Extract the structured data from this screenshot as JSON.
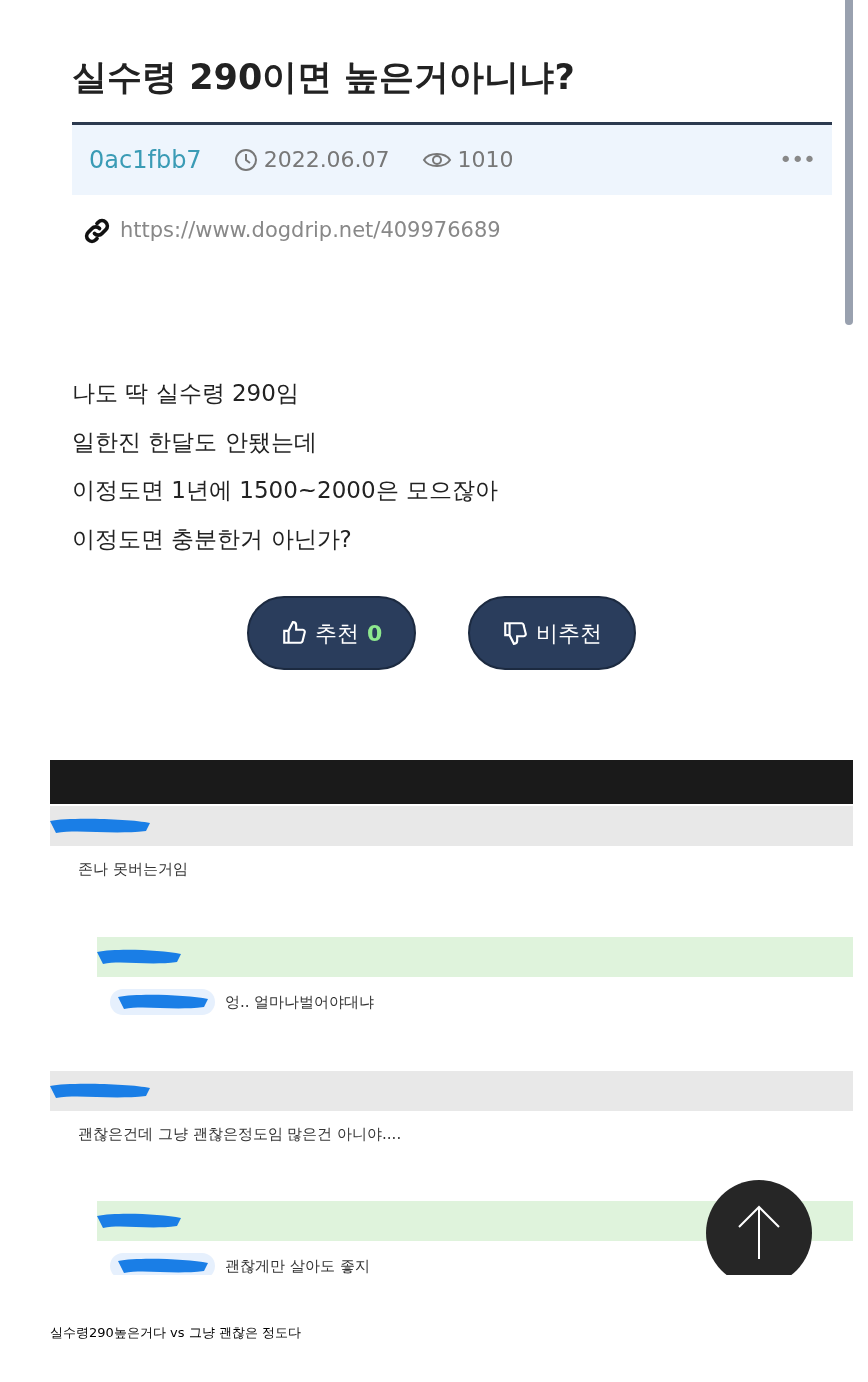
{
  "post": {
    "title": "실수령 290이면 높은거아니냐?",
    "author": "0ac1fbb7",
    "date": "2022.06.07",
    "views": "1010",
    "more": "•••",
    "url": "https://www.dogdrip.net/409976689",
    "body": [
      "나도 딱 실수령 290임",
      "일한진 한달도 안됐는데",
      "이정도면 1년에 1500~2000은 모으잖아",
      "이정도면 충분한거 아닌가?"
    ],
    "buttons": [
      {
        "kind": "up",
        "label": "추천",
        "count": "0"
      },
      {
        "kind": "down",
        "label": "비추천"
      }
    ]
  },
  "comments": [
    {
      "kind": "comment",
      "text": "존나 못버는거임"
    },
    {
      "kind": "reply",
      "text": "엉.. 얼마나벌어야대냐"
    },
    {
      "kind": "comment",
      "text": "괜찮은건데 그냥 괜찮은정도임 많은건 아니야...."
    },
    {
      "kind": "reply",
      "text": "괜찮게만 살아도 좋지"
    }
  ],
  "caption": "실수령290높은거다 vs 그냥 괜찮은 정도다"
}
